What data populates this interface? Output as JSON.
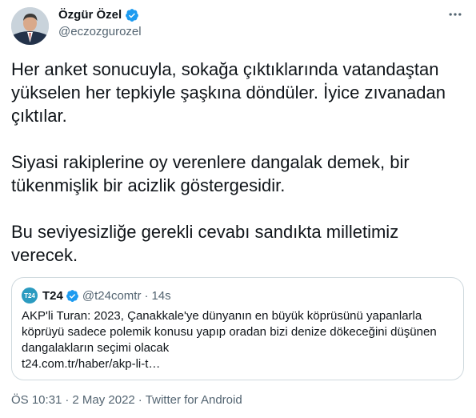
{
  "author": {
    "display_name": "Özgür Özel",
    "handle": "@eczozgurozel",
    "verified_icon": "verified-badge-icon",
    "badge_color": "#1d9bf0"
  },
  "tweet": {
    "paragraphs": [
      "Her anket sonucuyla, sokağa çıktıklarında vatandaştan yükselen her tepkiyle şaşkına döndüler. İyice zıvanadan çıktılar.",
      "Siyasi rakiplerine oy verenlere dangalak demek, bir tükenmişlik bir acizlik göstergesidir.",
      "Bu seviyesizliğe gerekli cevabı sandıkta milletimiz verecek."
    ]
  },
  "quote": {
    "logo_text": "T24",
    "name": "T24",
    "handle": "@t24comtr",
    "separator": "·",
    "time": "14s",
    "text_lines": [
      "AKP'li Turan: 2023, Çanakkale'ye dünyanın en büyük köprüsünü yapanlarla",
      "köprüyü sadece polemik konusu yapıp oradan bizi denize dökeceğini düşünen",
      "dangalakların seçimi olacak",
      "t24.com.tr/haber/akp-li-t…"
    ],
    "logo_color": "#2b9bc0"
  },
  "meta": {
    "time": "ÖS 10:31",
    "sep1": "·",
    "date": "2 May 2022",
    "sep2": "·",
    "source": "Twitter for Android"
  },
  "icons": {
    "more": "more-options-icon"
  }
}
